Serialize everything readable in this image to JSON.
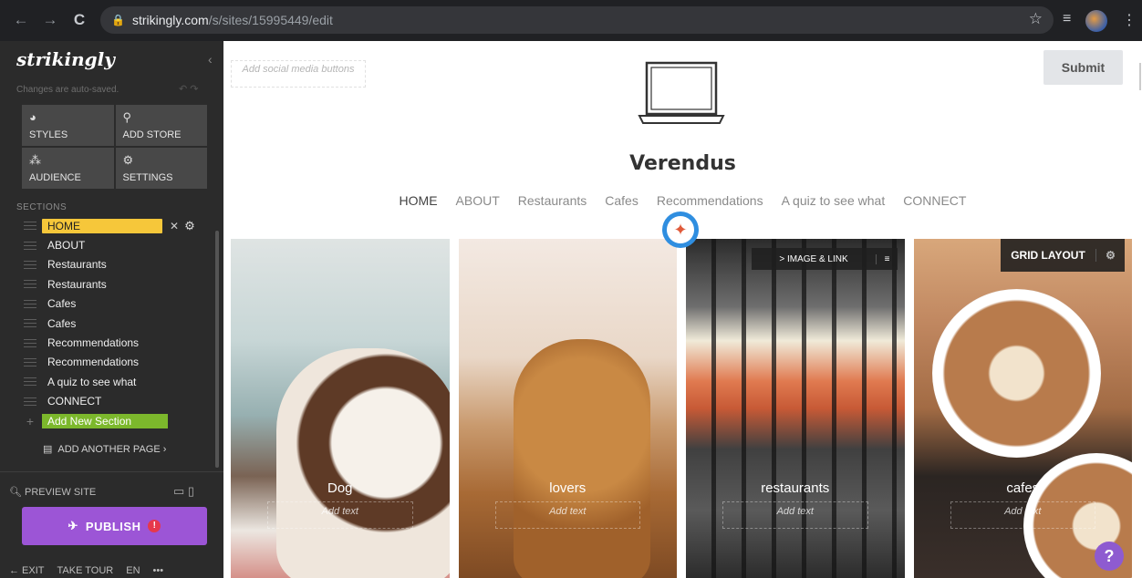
{
  "browser": {
    "url_host": "strikingly.com",
    "url_path": "/s/sites/15995449/edit",
    "back_icon": "←",
    "forward_icon": "→",
    "reload_icon": "C"
  },
  "sidebar": {
    "logo": "strikingly",
    "autosave": "Changes are auto-saved.",
    "tools": [
      {
        "label": "STYLES",
        "icon": "palette-icon"
      },
      {
        "label": "ADD STORE",
        "icon": "store-icon"
      },
      {
        "label": "AUDIENCE",
        "icon": "audience-icon"
      },
      {
        "label": "SETTINGS",
        "icon": "gear-icon"
      }
    ],
    "sections_heading": "SECTIONS",
    "sections": [
      "HOME",
      "ABOUT",
      "Restaurants",
      "Restaurants",
      "Cafes",
      "Cafes",
      "Recommendations",
      "Recommendations",
      "A quiz to see what",
      "CONNECT"
    ],
    "add_section": "Add New Section",
    "add_page": "ADD ANOTHER PAGE ›",
    "preview": "PREVIEW SITE",
    "publish": "PUBLISH",
    "publish_badge": "!",
    "footer": [
      "← EXIT",
      "TAKE TOUR",
      "EN",
      "•••"
    ]
  },
  "canvas": {
    "social_placeholder": "Add social media buttons",
    "submit": "Submit",
    "site_title": "Verendus",
    "nav": [
      "HOME",
      "ABOUT",
      "Restaurants",
      "Cafes",
      "Recommendations",
      "A quiz to see what",
      "CONNECT"
    ],
    "tiles": [
      {
        "caption": "Dog",
        "sub": "Add text"
      },
      {
        "caption": "lovers",
        "sub": "Add text"
      },
      {
        "caption": "restaurants",
        "sub": "Add text"
      },
      {
        "caption": "cafes",
        "sub": "Add text"
      }
    ],
    "tile_toolbar": "> IMAGE & LINK",
    "grid_layout": "GRID LAYOUT",
    "help": "?"
  },
  "colors": {
    "active_section": "#f6c73a",
    "add_section": "#7cb82c",
    "publish": "#9c55d6",
    "compass": "#2f8ee0"
  }
}
